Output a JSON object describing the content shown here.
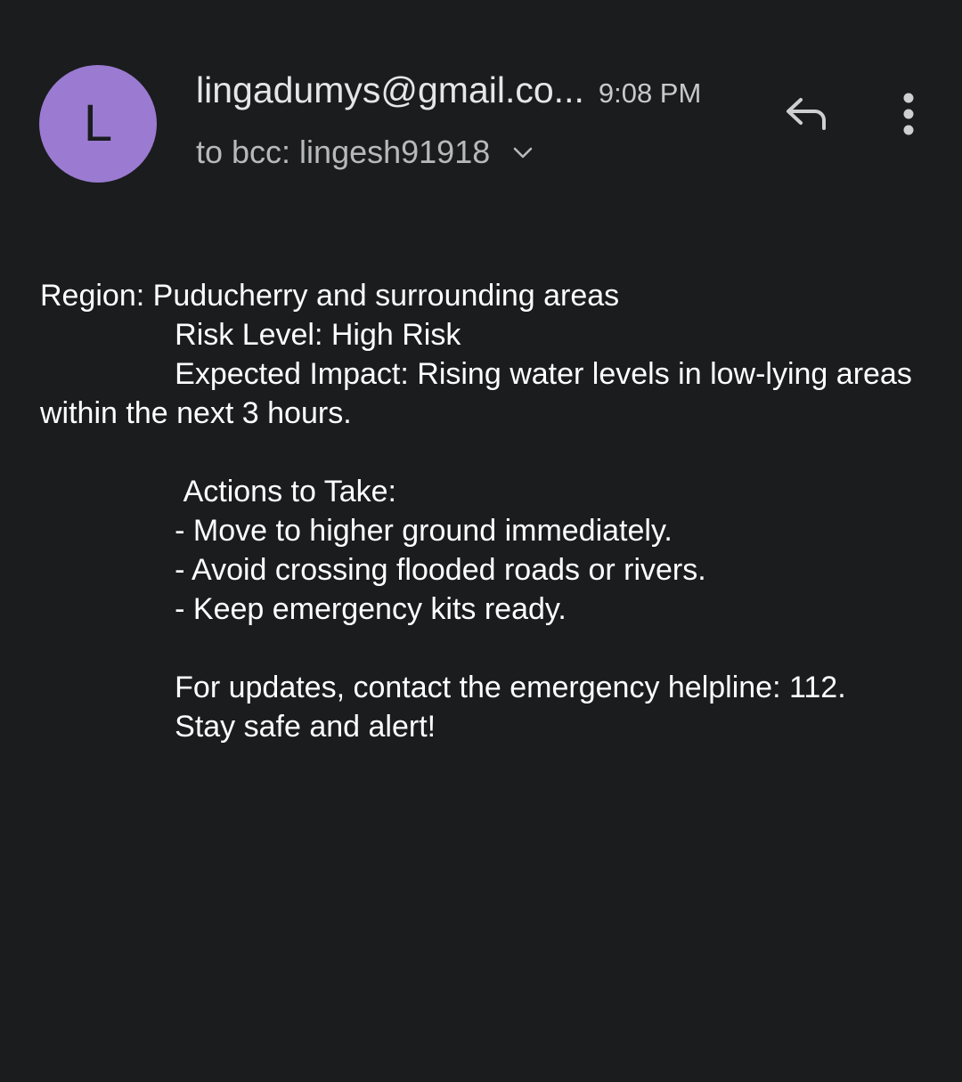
{
  "header": {
    "avatar_letter": "L",
    "avatar_color": "#9a7bd1",
    "sender": "lingadumys@gmail.co...",
    "time": "9:08 PM",
    "recipient": "to bcc: lingesh91918",
    "recipient_expand_icon": "chevron-down-icon",
    "reply_icon": "reply-icon",
    "more_icon": "more-vert-icon"
  },
  "message": {
    "body": "Region: Puducherry and surrounding areas\n                Risk Level: High Risk\n                Expected Impact: Rising water levels in low-lying areas within the next 3 hours.\n\n                 Actions to Take:\n                - Move to higher ground immediately.\n                - Avoid crossing flooded roads or rivers.\n                - Keep emergency kits ready.\n\n                For updates, contact the emergency helpline: 112.\n                Stay safe and alert!"
  }
}
